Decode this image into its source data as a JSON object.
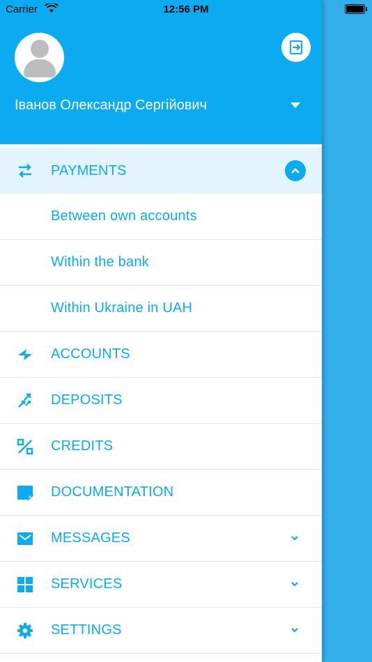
{
  "status_bar": {
    "carrier": "Carrier",
    "time": "12:56 PM"
  },
  "user": {
    "name": "Іванов Олександр Сергійович"
  },
  "menu": {
    "payments": "PAYMENTS",
    "payment_subitems": [
      "Between own accounts",
      "Within the bank",
      "Within Ukraine in UAH"
    ],
    "accounts": "ACCOUNTS",
    "deposits": "DEPOSITS",
    "credits": "CREDITS",
    "documentation": "DOCUMENTATION",
    "messages": "MESSAGES",
    "services": "SERVICES",
    "settings": "SETTINGS"
  },
  "colors": {
    "accent": "#0aabf0",
    "active_bg": "#e3f4fd",
    "backdrop": "#32aee8"
  },
  "icons": {
    "payments": "transfer-arrows-icon",
    "accounts": "accounts-icon",
    "deposits": "deposits-arrows-icon",
    "credits": "percent-icon",
    "documentation": "document-icon",
    "messages": "envelope-icon",
    "services": "grid-icon",
    "settings": "gear-icon"
  }
}
